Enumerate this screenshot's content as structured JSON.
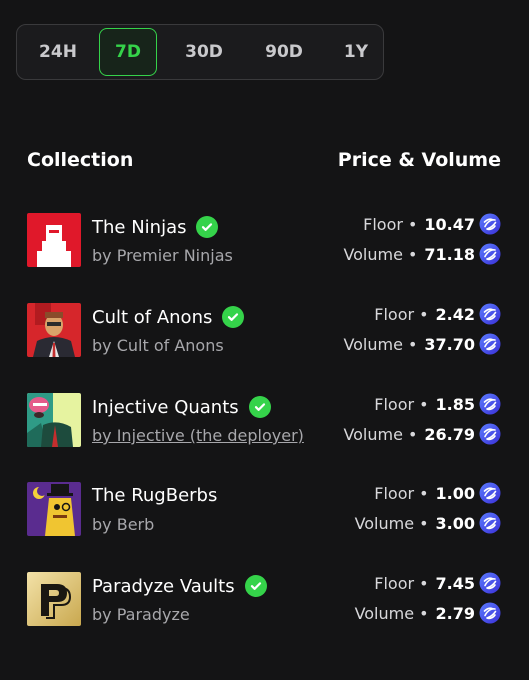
{
  "tabs": [
    {
      "label": "24H",
      "active": false
    },
    {
      "label": "7D",
      "active": true
    },
    {
      "label": "30D",
      "active": false
    },
    {
      "label": "90D",
      "active": false
    },
    {
      "label": "1Y",
      "active": false
    }
  ],
  "table": {
    "col_collection": "Collection",
    "col_price_volume": "Price & Volume",
    "floor_label": "Floor",
    "volume_label": "Volume",
    "separator": "•"
  },
  "collections": [
    {
      "name": "The Ninjas",
      "verified": true,
      "creator": "by Premier Ninjas",
      "floor": "10.47",
      "volume": "71.18"
    },
    {
      "name": "Cult of Anons",
      "verified": true,
      "creator": "by Cult of Anons",
      "floor": "2.42",
      "volume": "37.70"
    },
    {
      "name": "Injective Quants",
      "verified": true,
      "creator": "by Injective (the deployer)",
      "floor": "1.85",
      "volume": "26.79"
    },
    {
      "name": "The RugBerbs",
      "verified": false,
      "creator": "by Berb",
      "floor": "1.00",
      "volume": "3.00"
    },
    {
      "name": "Paradyze Vaults",
      "verified": true,
      "creator": "by Paradyze",
      "floor": "7.45",
      "volume": "2.79"
    }
  ],
  "colors": {
    "accent": "#35d34a",
    "background": "#141415",
    "token": "#3b5bff"
  },
  "icons": {
    "verified": "verified-check-icon",
    "token": "injective-token-icon"
  }
}
